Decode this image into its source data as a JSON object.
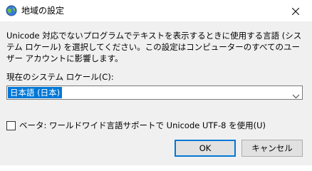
{
  "window": {
    "title": "地域の設定",
    "icon": "globe-icon",
    "close_icon": "close-icon"
  },
  "description": "Unicode 対応でないプログラムでテキストを表示するときに使用する言語 (システム ロケール) を選択してください。この設定はコンピューターのすべてのユーザー アカウントに影響します。",
  "locale": {
    "label": "現在のシステム ロケール(C):",
    "selected": "日本語 (日本)"
  },
  "beta": {
    "label": "ベータ: ワールドワイド言語サポートで Unicode UTF-8 を使用(U)",
    "checked": false
  },
  "buttons": {
    "ok": "OK",
    "cancel": "キャンセル"
  },
  "colors": {
    "accent": "#0078d7",
    "dialog_bg": "#f0f0f0",
    "button_bg": "#e1e1e1"
  }
}
